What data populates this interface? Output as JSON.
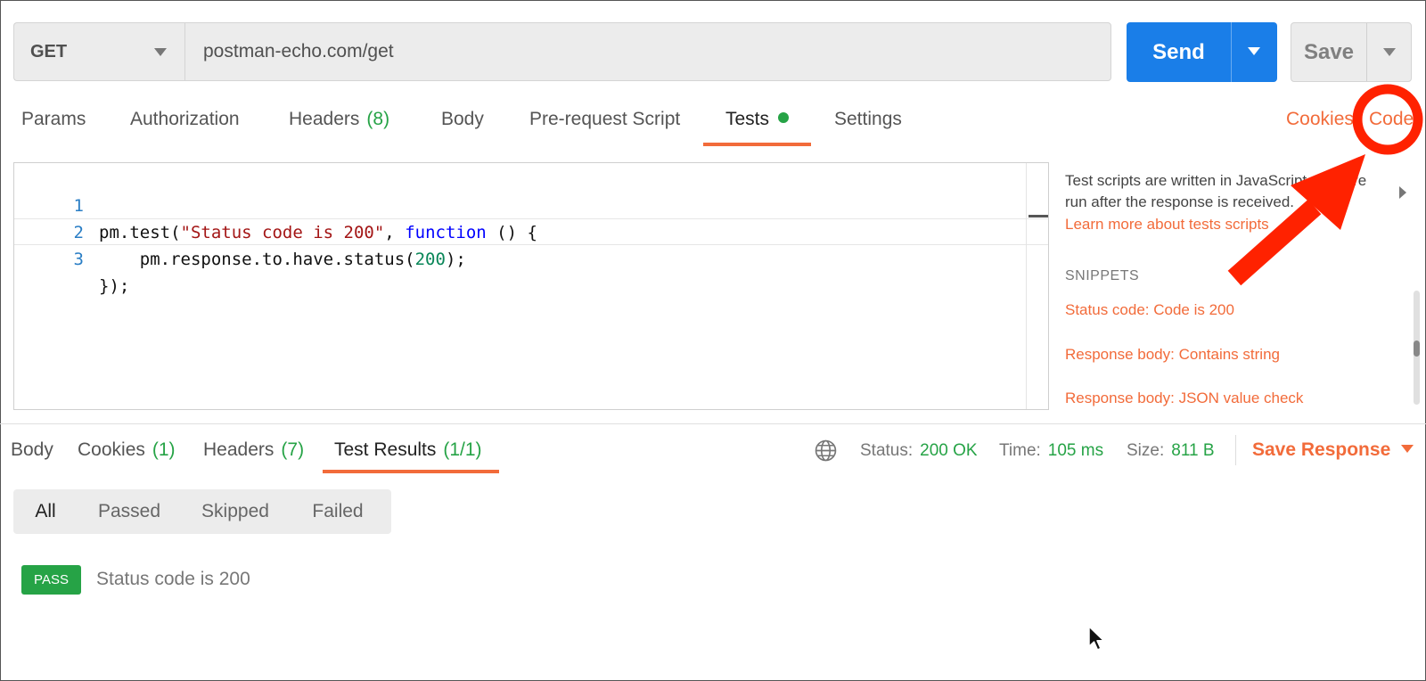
{
  "request": {
    "method": "GET",
    "url": "postman-echo.com/get",
    "send_label": "Send",
    "save_label": "Save"
  },
  "request_tabs": [
    {
      "label": "Params"
    },
    {
      "label": "Authorization"
    },
    {
      "label": "Headers",
      "count": "(8)"
    },
    {
      "label": "Body"
    },
    {
      "label": "Pre-request Script"
    },
    {
      "label": "Tests",
      "active": true
    },
    {
      "label": "Settings"
    }
  ],
  "links": {
    "cookies": "Cookies",
    "code": "Code"
  },
  "editor": {
    "lines": [
      {
        "num": "1",
        "tokens": [
          "pm.test(",
          "\"Status code is 200\"",
          ", ",
          "function",
          " () {"
        ]
      },
      {
        "num": "2",
        "tokens": [
          "    pm.response.to.have.status(",
          "200",
          ");"
        ]
      },
      {
        "num": "3",
        "tokens": [
          "});"
        ]
      }
    ]
  },
  "sidebar": {
    "description_1": "Test scripts are written in JavaScript, and are",
    "description_2": "run after the response is received.",
    "learn_more": "Learn more about tests scripts",
    "snippets_heading": "SNIPPETS",
    "snippets": [
      "Status code: Code is 200",
      "Response body: Contains string",
      "Response body: JSON value check"
    ]
  },
  "response_tabs": [
    {
      "label": "Body"
    },
    {
      "label": "Cookies",
      "count": "(1)"
    },
    {
      "label": "Headers",
      "count": "(7)"
    },
    {
      "label": "Test Results",
      "count": "(1/1)",
      "active": true
    }
  ],
  "response_meta": {
    "status_label": "Status:",
    "status_value": "200 OK",
    "time_label": "Time:",
    "time_value": "105 ms",
    "size_label": "Size:",
    "size_value": "811 B",
    "save_response": "Save Response"
  },
  "filters": [
    "All",
    "Passed",
    "Skipped",
    "Failed"
  ],
  "results": [
    {
      "badge": "PASS",
      "name": "Status code is 200"
    }
  ],
  "colors": {
    "accent": "#f26b3a",
    "primary": "#1a7ee8",
    "success": "#26a346",
    "annotation": "#ff2200"
  }
}
